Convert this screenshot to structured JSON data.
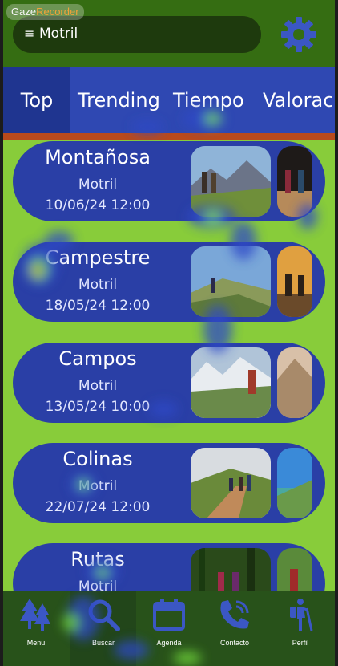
{
  "watermark": {
    "part1": "Gaze",
    "part2": "Recorder"
  },
  "header": {
    "menu_glyph": "≡",
    "location": "Motril",
    "settings_icon": "gear-icon"
  },
  "tabs": [
    {
      "label": "Top",
      "active": true
    },
    {
      "label": "Trending",
      "active": false
    },
    {
      "label": "Tiempo",
      "active": false
    },
    {
      "label": "Valoraciones",
      "active": false
    }
  ],
  "routes": [
    {
      "title": "Montañosa",
      "place": "Motril",
      "date": "10/06/24 12:00"
    },
    {
      "title": "Campestre",
      "place": "Motril",
      "date": "18/05/24 12:00"
    },
    {
      "title": "Campos",
      "place": "Motril",
      "date": "13/05/24 10:00"
    },
    {
      "title": "Colinas",
      "place": "Motril",
      "date": "22/07/24 12:00"
    },
    {
      "title": "Rutas",
      "place": "Motril",
      "date": ""
    }
  ],
  "nav": [
    {
      "label": "Menu",
      "icon": "trees-icon"
    },
    {
      "label": "Buscar",
      "icon": "search-icon"
    },
    {
      "label": "Agenda",
      "icon": "calendar-icon"
    },
    {
      "label": "Contacto",
      "icon": "phone-icon"
    },
    {
      "label": "Perfil",
      "icon": "hiker-icon"
    }
  ],
  "colors": {
    "background": "#88cc3a",
    "header": "#356d12",
    "tab_bar": "#2f48b2",
    "tab_active": "#1f3590",
    "tab_underline": "#b94a1c",
    "card": "#2a3fa6",
    "nav_bar": "#28521a",
    "icon": "#3b57c4"
  }
}
